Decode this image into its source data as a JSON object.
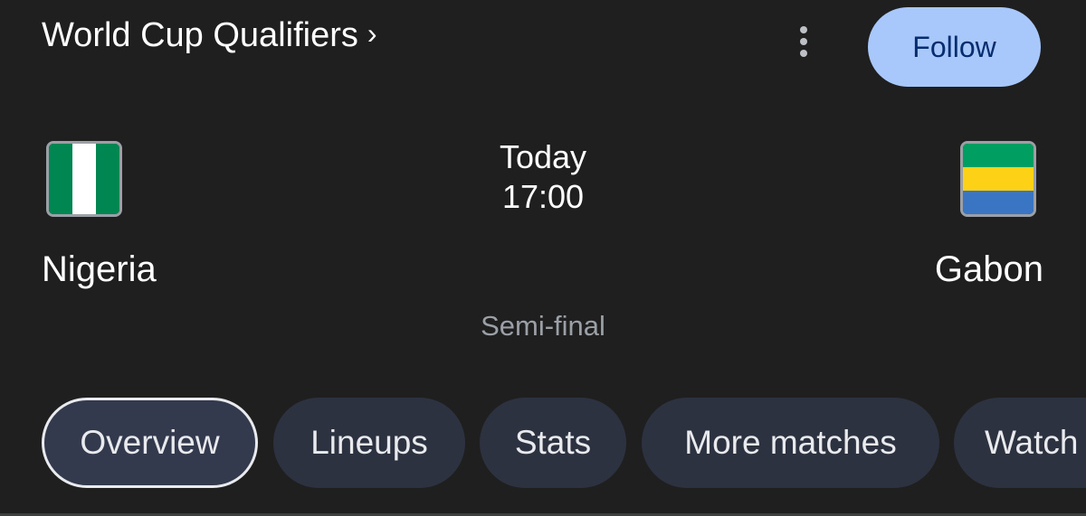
{
  "header": {
    "competition": "World Cup Qualifiers",
    "chevron": "›",
    "more_icon": "more-vert-icon",
    "follow_label": "Follow"
  },
  "match": {
    "home": {
      "name": "Nigeria",
      "flag_colors": [
        "#008751",
        "#ffffff",
        "#008751"
      ]
    },
    "away": {
      "name": "Gabon",
      "flag_colors": [
        "#009e60",
        "#fcd116",
        "#3a75c4"
      ]
    },
    "day": "Today",
    "time": "17:00",
    "round": "Semi-final"
  },
  "tabs": [
    {
      "label": "Overview",
      "active": true
    },
    {
      "label": "Lineups",
      "active": false
    },
    {
      "label": "Stats",
      "active": false
    },
    {
      "label": "More matches",
      "active": false
    },
    {
      "label": "Watch",
      "active": false
    }
  ],
  "colors": {
    "background": "#1f1f1f",
    "follow_bg": "#a8c7fa",
    "follow_text": "#062e6f",
    "tab_bg": "#2d3240",
    "muted_text": "#9aa0a6"
  }
}
